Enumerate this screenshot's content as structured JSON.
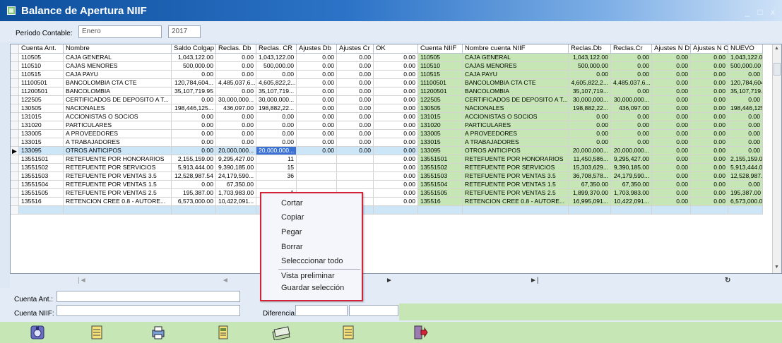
{
  "window": {
    "title": "Balance de Apertura NIIF",
    "controls": "_ □ x"
  },
  "period": {
    "label": "Período Contable:",
    "month": "Enero",
    "year": "2017"
  },
  "columns": [
    "Cuenta Ant.",
    "Nombre",
    "Saldo Colgap",
    "Reclas. Db",
    "Reclas. CR",
    "Ajustes Db",
    "Ajustes Cr",
    "OK",
    "Cuenta NIIF",
    "Nombre cuenta NIIF",
    "Reclas.Db",
    "Reclas.Cr",
    "Ajustes N Dt",
    "Ajustes N Cr",
    "NUEVO"
  ],
  "rows": [
    [
      "110505",
      "CAJA GENERAL",
      "1,043,122.00",
      "0.00",
      "1,043,122.00",
      "0.00",
      "0.00",
      "0.00",
      "110505",
      "CAJA GENERAL",
      "1,043,122.00",
      "0.00",
      "0.00",
      "0.00",
      "1,043,122.00"
    ],
    [
      "110510",
      "CAJAS MENORES",
      "500,000.00",
      "0.00",
      "500,000.00",
      "0.00",
      "0.00",
      "0.00",
      "110510",
      "CAJAS MENORES",
      "500,000.00",
      "0.00",
      "0.00",
      "0.00",
      "500,000.00"
    ],
    [
      "110515",
      "CAJA PAYU",
      "0.00",
      "0.00",
      "0.00",
      "0.00",
      "0.00",
      "0.00",
      "110515",
      "CAJA PAYU",
      "0.00",
      "0.00",
      "0.00",
      "0.00",
      "0.00"
    ],
    [
      "11100501",
      "BANCOLOMBIA CTA CTE",
      "120,784,604...",
      "4,485,037,6...",
      "4,605,822,2...",
      "0.00",
      "0.00",
      "0.00",
      "11100501",
      "BANCOLOMBIA CTA CTE",
      "4,605,822,2...",
      "4,485,037,6...",
      "0.00",
      "0.00",
      "120,784,604..."
    ],
    [
      "11200501",
      "BANCOLOMBIA",
      "35,107,719.95",
      "0.00",
      "35,107,719...",
      "0.00",
      "0.00",
      "0.00",
      "11200501",
      "BANCOLOMBIA",
      "35,107,719...",
      "0.00",
      "0.00",
      "0.00",
      "35,107,719.95"
    ],
    [
      "122505",
      "CERTIFICADOS DE DEPOSITO A T...",
      "0.00",
      "30,000,000...",
      "30,000,000...",
      "0.00",
      "0.00",
      "0.00",
      "122505",
      "CERTIFICADOS DE DEPOSITO A T...",
      "30,000,000...",
      "30,000,000...",
      "0.00",
      "0.00",
      "0.00"
    ],
    [
      "130505",
      "NACIONALES",
      "198,446,125...",
      "436,097.00",
      "198,882,22...",
      "0.00",
      "0.00",
      "0.00",
      "130505",
      "NACIONALES",
      "198,882,22...",
      "436,097.00",
      "0.00",
      "0.00",
      "198,446,125..."
    ],
    [
      "131015",
      "ACCIONISTAS O SOCIOS",
      "0.00",
      "0.00",
      "0.00",
      "0.00",
      "0.00",
      "0.00",
      "131015",
      "ACCIONISTAS O SOCIOS",
      "0.00",
      "0.00",
      "0.00",
      "0.00",
      "0.00"
    ],
    [
      "131020",
      "PARTICULARES",
      "0.00",
      "0.00",
      "0.00",
      "0.00",
      "0.00",
      "0.00",
      "131020",
      "PARTICULARES",
      "0.00",
      "0.00",
      "0.00",
      "0.00",
      "0.00"
    ],
    [
      "133005",
      "A PROVEEDORES",
      "0.00",
      "0.00",
      "0.00",
      "0.00",
      "0.00",
      "0.00",
      "133005",
      "A PROVEEDORES",
      "0.00",
      "0.00",
      "0.00",
      "0.00",
      "0.00"
    ],
    [
      "133015",
      "A TRABAJADORES",
      "0.00",
      "0.00",
      "0.00",
      "0.00",
      "0.00",
      "0.00",
      "133015",
      "A TRABAJADORES",
      "0.00",
      "0.00",
      "0.00",
      "0.00",
      "0.00"
    ],
    [
      "133095",
      "OTROS ANTICIPOS",
      "0.00",
      "20,000,000...",
      "20,000,000...",
      "0.00",
      "0.00",
      "0.00",
      "133095",
      "OTROS ANTICIPOS",
      "20,000,000...",
      "20,000,000...",
      "0.00",
      "0.00",
      "0.00"
    ],
    [
      "13551501",
      "RETEFUENTE POR HONORARIOS",
      "2,155,159.00",
      "9,295,427.00",
      "11",
      "",
      "",
      "0.00",
      "13551501",
      "RETEFUENTE POR HONORARIOS",
      "11,450,586...",
      "9,295,427.00",
      "0.00",
      "0.00",
      "2,155,159.00"
    ],
    [
      "13551502",
      "RETEFUENTE POR SERVICIOS",
      "5,913,444.00",
      "9,390,185.00",
      "15",
      "",
      "",
      "0.00",
      "13551502",
      "RETEFUENTE POR SERVICIOS",
      "15,303,629...",
      "9,390,185.00",
      "0.00",
      "0.00",
      "5,913,444.00"
    ],
    [
      "13551503",
      "RETEFUENTE POR VENTAS 3.5",
      "12,528,987.54",
      "24,179,590...",
      "36",
      "",
      "",
      "0.00",
      "13551503",
      "RETEFUENTE POR VENTAS 3.5",
      "36,708,578...",
      "24,179,590...",
      "0.00",
      "0.00",
      "12,528,987.54"
    ],
    [
      "13551504",
      "RETEFUENTE POR VENTAS 1.5",
      "0.00",
      "67,350.00",
      "",
      "",
      "",
      "0.00",
      "13551504",
      "RETEFUENTE POR VENTAS 1.5",
      "67,350.00",
      "67,350.00",
      "0.00",
      "0.00",
      "0.00"
    ],
    [
      "13551505",
      "RETEFUENTE POR VENTAS 2.5",
      "195,387.00",
      "1,703,983.00",
      "1",
      "",
      "",
      "0.00",
      "13551505",
      "RETEFUENTE POR VENTAS 2.5",
      "1,899,370.00",
      "1,703,983.00",
      "0.00",
      "0.00",
      "195,387.00"
    ],
    [
      "135516",
      "RETENCION CREE 0.8 - AUTORE...",
      "6,573,000.00",
      "10,422,091...",
      "16",
      "",
      "",
      "0.00",
      "135516",
      "RETENCION CREE 0.8 - AUTORE...",
      "16,995,091...",
      "10,422,091...",
      "0.00",
      "0.00",
      "6,573,000.00"
    ]
  ],
  "current_row_index": 11,
  "nav": {
    "first": "|◄",
    "prev": "◄",
    "next": "►",
    "last": "►|",
    "refresh": "↻"
  },
  "bottom": {
    "cuenta_ant_label": "Cuenta Ant.:",
    "cuenta_niif_label": "Cuenta NIIF:",
    "diferencia_label": "Diferencia:"
  },
  "context_menu": [
    "Cortar",
    "Copiar",
    "Pegar",
    "Borrar",
    "Selecccionar todo",
    "Vista preliminar",
    "Guardar selección"
  ],
  "colors": {
    "accent_green": "#c6e7b5",
    "title_blue": "#0d4f9c",
    "menu_border": "#d2233a"
  }
}
